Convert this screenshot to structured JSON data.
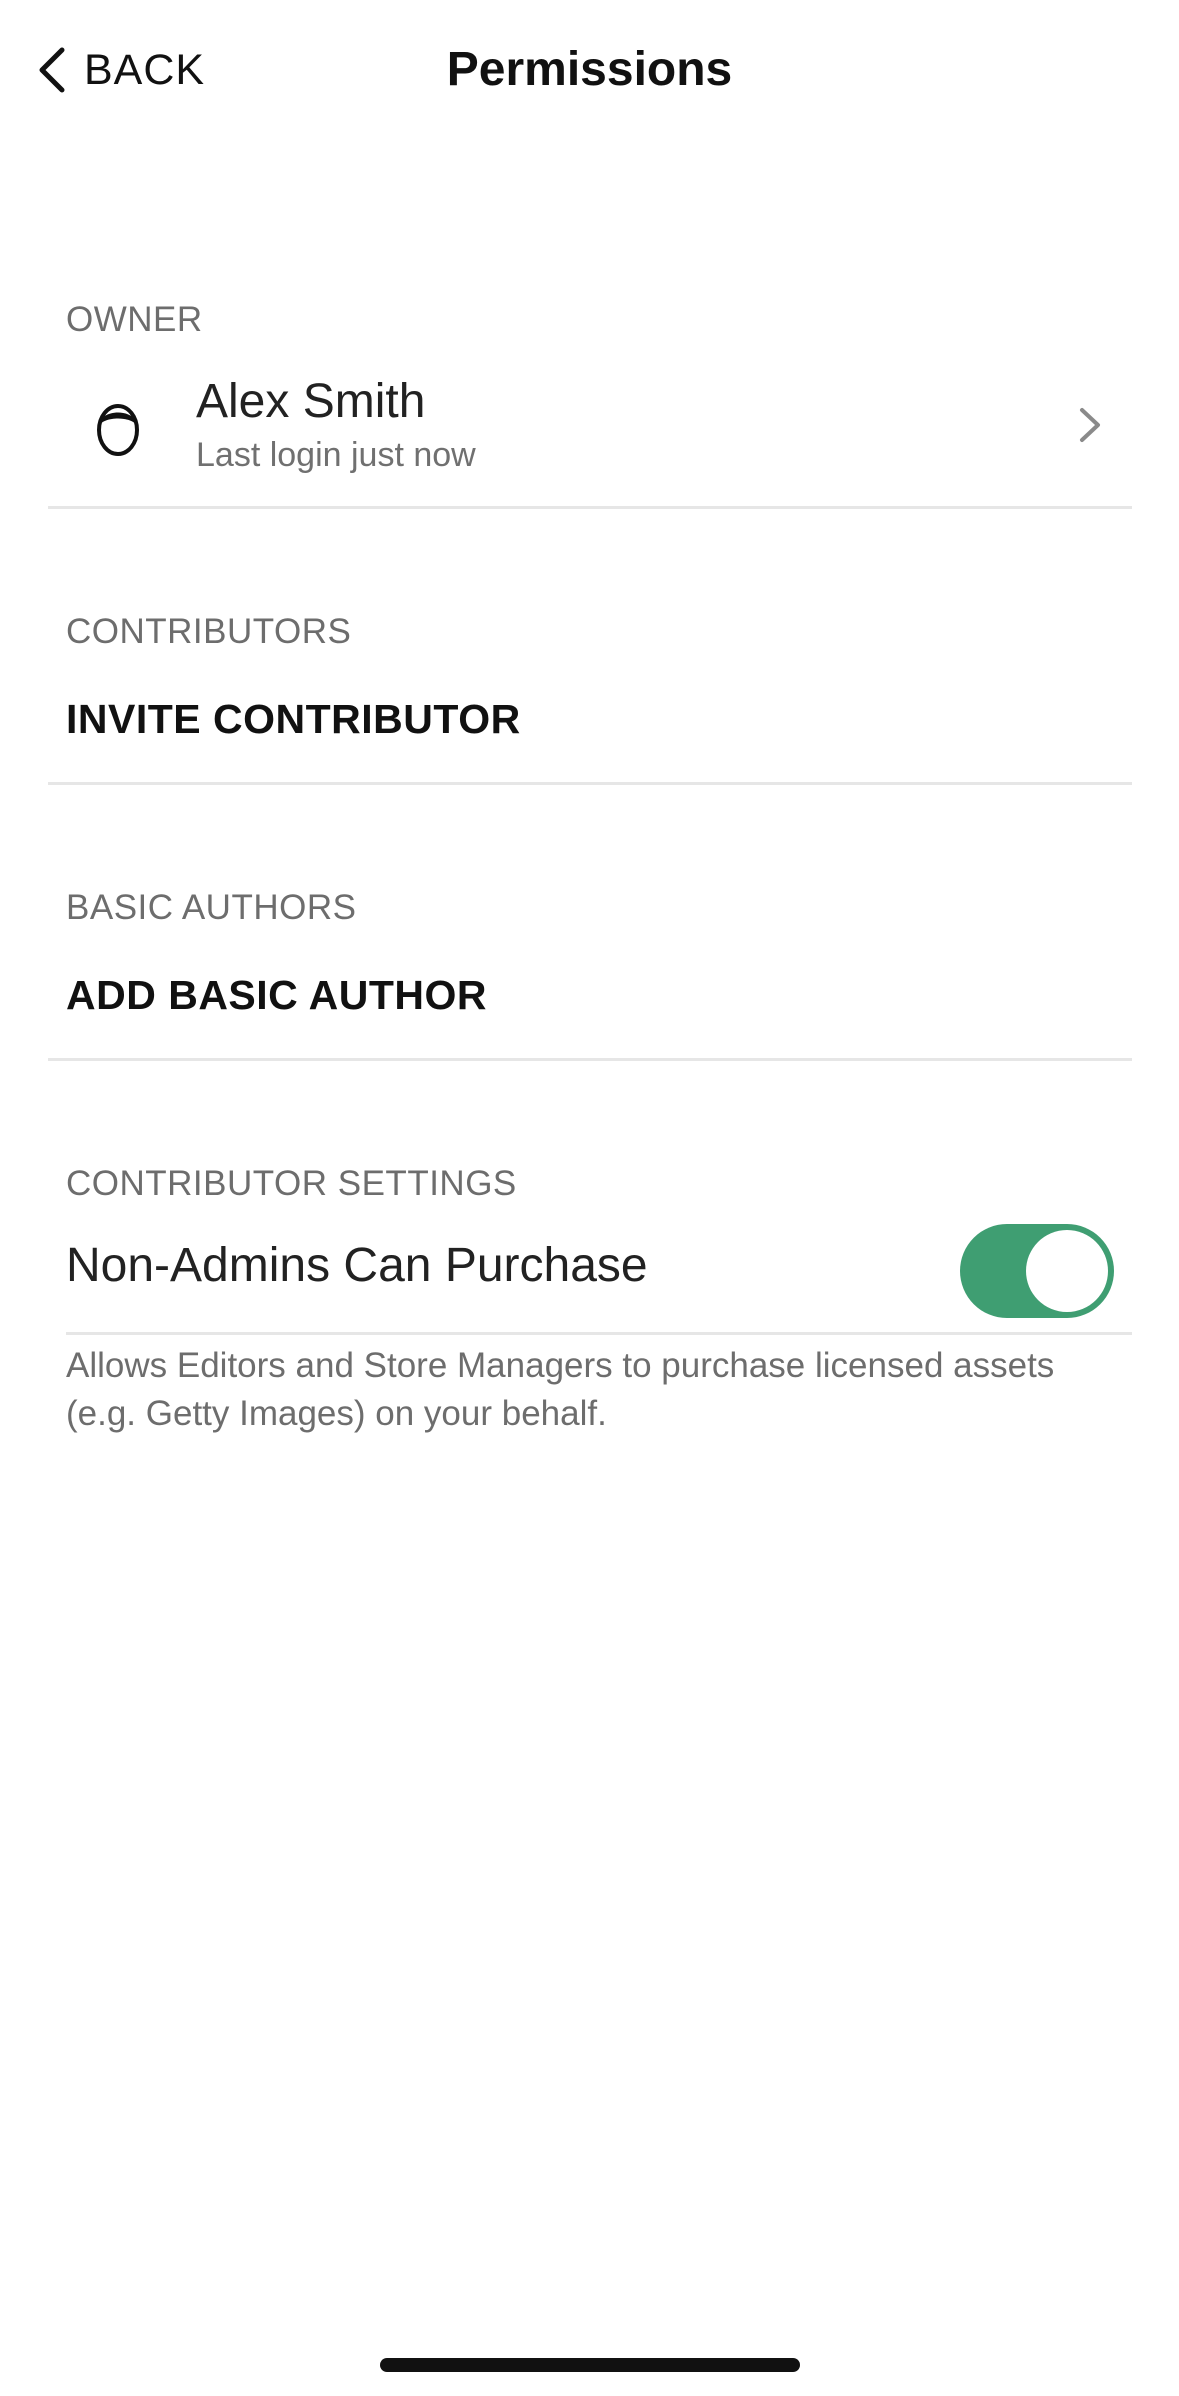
{
  "header": {
    "back_label": "BACK",
    "title": "Permissions"
  },
  "owner": {
    "section_label": "OWNER",
    "name": "Alex Smith",
    "last_login": "Last login just now"
  },
  "contributors": {
    "section_label": "CONTRIBUTORS",
    "action_label": "INVITE CONTRIBUTOR"
  },
  "basic_authors": {
    "section_label": "BASIC AUTHORS",
    "action_label": "ADD BASIC AUTHOR"
  },
  "contributor_settings": {
    "section_label": "CONTRIBUTOR SETTINGS",
    "setting_label": "Non-Admins Can Purchase",
    "toggle_on": true,
    "help_text": "Allows Editors and Store Managers to purchase licensed assets (e.g. Getty Images) on your behalf."
  },
  "colors": {
    "toggle_on": "#3f9e72",
    "text_primary": "#111111",
    "text_secondary": "#6d6d6d",
    "divider": "#e6e6e6"
  },
  "icons": {
    "back": "chevron-left-icon",
    "avatar": "avatar-face-icon",
    "row_chevron": "chevron-right-icon"
  }
}
